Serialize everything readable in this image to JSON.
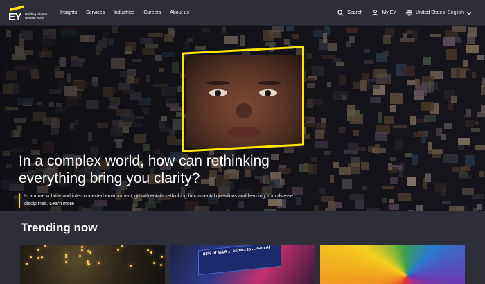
{
  "brand": {
    "logo_text": "EY",
    "tagline": "Building a better working world",
    "accent_color": "#ffe600"
  },
  "nav": {
    "links": [
      "Insights",
      "Services",
      "Industries",
      "Careers",
      "About us"
    ],
    "search_label": "Search",
    "my_ey_label": "My EY",
    "region_label": "United States",
    "language_label": "English"
  },
  "hero": {
    "title": "In a complex world, how can rethinking everything bring you clarity?",
    "body": "In a more volatile and interconnected environment, growth entails rethinking fundamental questions and learning from diverse disciplines.",
    "link_label": "Learn more"
  },
  "trending": {
    "heading": "Trending now",
    "card2_sign": "83% of M&A ... expect to ... Gen AI"
  },
  "icons": {
    "search": "search-icon",
    "user": "user-icon",
    "globe": "globe-icon",
    "chevron": "chevron-down-icon"
  }
}
